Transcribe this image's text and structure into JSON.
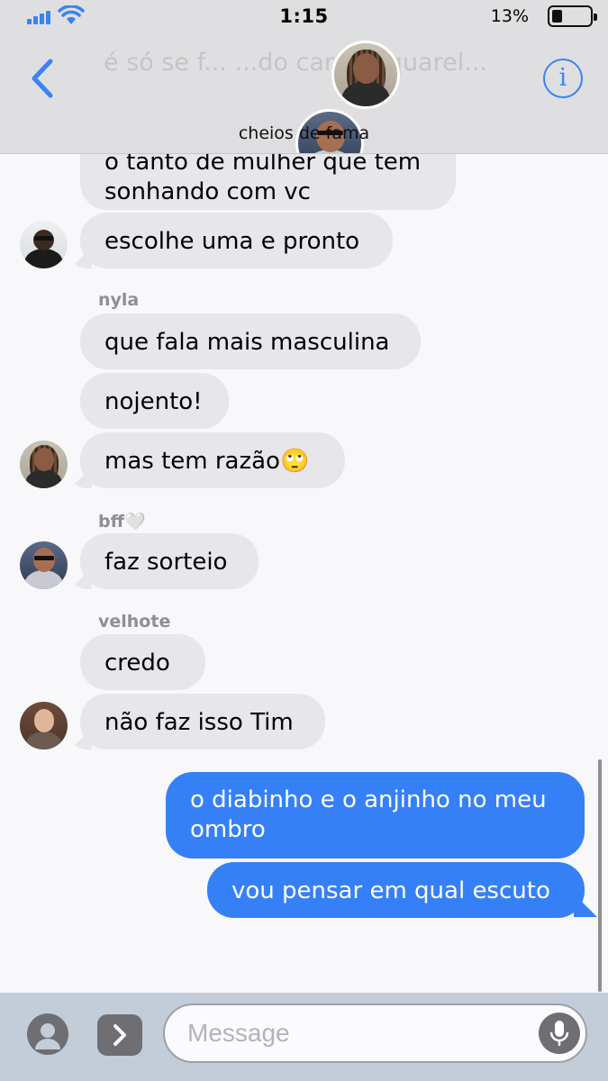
{
  "status_bar": {
    "time": "1:15",
    "battery_percent": "13%",
    "battery_level": 0.13
  },
  "header": {
    "group_name": "cheios de fama",
    "ghost_text": "é só se f... ...do cara   aquarel..."
  },
  "messages": [
    {
      "id": "m1",
      "direction": "in",
      "text_line1": "o tanto de mulher que tem",
      "text_line2": "sonhando com vc"
    },
    {
      "id": "m2",
      "direction": "in",
      "text": "escolhe uma e pronto",
      "avatar": "avatar-a"
    },
    {
      "id": "s1",
      "sender": "nyla"
    },
    {
      "id": "m3",
      "direction": "in",
      "text": "que fala mais masculina"
    },
    {
      "id": "m4",
      "direction": "in",
      "text": "nojento!"
    },
    {
      "id": "m5",
      "direction": "in",
      "text": "mas tem razão🙄",
      "avatar": "avatar-d"
    },
    {
      "id": "s2",
      "sender": "bff🤍"
    },
    {
      "id": "m6",
      "direction": "in",
      "text": "faz sorteio",
      "avatar": "avatar-c"
    },
    {
      "id": "s3",
      "sender": "velhote"
    },
    {
      "id": "m7",
      "direction": "in",
      "text": "credo"
    },
    {
      "id": "m8",
      "direction": "in",
      "text": "não faz isso Tim",
      "avatar": "avatar-b"
    },
    {
      "id": "m9",
      "direction": "out",
      "text_line1": "o diabinho e o anjinho no meu",
      "text_line2": "ombro"
    },
    {
      "id": "m10",
      "direction": "out",
      "text": "vou pensar em qual escuto"
    }
  ],
  "input": {
    "placeholder": "Message",
    "value": ""
  },
  "icons": {
    "back": "chevron-left-icon",
    "info": "info-icon",
    "camera": "camera-icon",
    "apps": "apps-icon",
    "mic": "microphone-icon"
  },
  "colors": {
    "accent": "#3a82f7",
    "outgoing_bubble": "#3680f7",
    "incoming_bubble": "#e6e6eb",
    "sender_label": "#8e8e93"
  }
}
